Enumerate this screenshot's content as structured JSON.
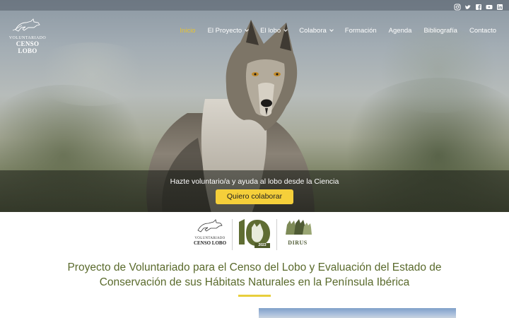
{
  "logo": {
    "line1": "Voluntariado",
    "line2": "Censo Lobo"
  },
  "nav": {
    "items": [
      {
        "label": "Inicio",
        "active": true,
        "dropdown": false
      },
      {
        "label": "El Proyecto",
        "active": false,
        "dropdown": true
      },
      {
        "label": "El lobo",
        "active": false,
        "dropdown": true
      },
      {
        "label": "Colabora",
        "active": false,
        "dropdown": true
      },
      {
        "label": "Formación",
        "active": false,
        "dropdown": false
      },
      {
        "label": "Agenda",
        "active": false,
        "dropdown": false
      },
      {
        "label": "Bibliografía",
        "active": false,
        "dropdown": false
      },
      {
        "label": "Contacto",
        "active": false,
        "dropdown": false
      }
    ],
    "active_color": "#e5c335"
  },
  "social_icons": [
    "instagram-icon",
    "twitter-icon",
    "facebook-icon",
    "youtube-icon",
    "linkedin-icon"
  ],
  "hero": {
    "tagline": "Hazte voluntario/a y ayuda al lobo desde la Ciencia",
    "cta_label": "Quiero colaborar",
    "cta_color": "#f5cf3a"
  },
  "partners": {
    "left_logo": {
      "line1": "Voluntariado",
      "line2": "Censo Lobo"
    },
    "anniversary_year": "2023",
    "anniversary_number": "10",
    "right_logo": "DIRUS"
  },
  "section": {
    "title": "Proyecto de Voluntariado para el Censo del Lobo y Evaluación del Estado de Conservación de sus Hábitats Naturales en la Península Ibérica",
    "title_color": "#5a6a2c",
    "accent_color": "#e8cf3c"
  }
}
